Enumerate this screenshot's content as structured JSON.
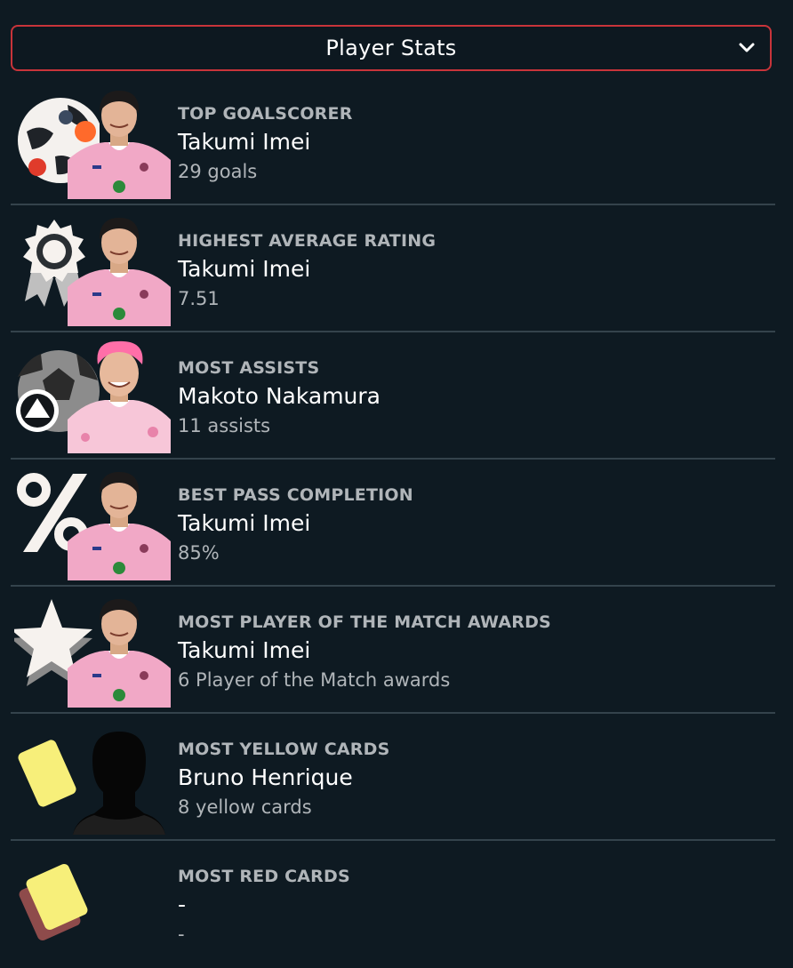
{
  "header": {
    "dropdown_label": "Player Stats",
    "dropdown_icon": "chevron-down-icon"
  },
  "colors": {
    "background": "#0e1a22",
    "dropdown_border": "#c8343a",
    "divider": "#34434c",
    "category_text": "#b0b5b9",
    "player_text": "#ffffff",
    "value_text": "#b0b5b9",
    "jersey_pink": "#f1a8c6",
    "yellow_card": "#f7ef7a",
    "red_card_dark": "#8e4b4b"
  },
  "stats": [
    {
      "category": "TOP GOALSCORER",
      "player": "Takumi Imei",
      "value": "29 goals",
      "icon": "soccer-ball-icon",
      "portrait": "player-portrait"
    },
    {
      "category": "HIGHEST AVERAGE RATING",
      "player": "Takumi Imei",
      "value": "7.51",
      "icon": "award-rosette-icon",
      "portrait": "player-portrait"
    },
    {
      "category": "MOST ASSISTS",
      "player": "Makoto Nakamura",
      "value": "11 assists",
      "icon": "assist-ball-icon",
      "portrait": "player-portrait-pink-hair"
    },
    {
      "category": "BEST PASS COMPLETION",
      "player": "Takumi Imei",
      "value": "85%",
      "icon": "percent-icon",
      "portrait": "player-portrait"
    },
    {
      "category": "MOST PLAYER OF THE MATCH AWARDS",
      "player": "Takumi Imei",
      "value": "6 Player of the Match awards",
      "icon": "star-icon",
      "portrait": "player-portrait"
    },
    {
      "category": "MOST YELLOW CARDS",
      "player": "Bruno Henrique",
      "value": "8 yellow cards",
      "icon": "yellow-card-icon",
      "portrait": "silhouette-portrait"
    },
    {
      "category": "MOST RED CARDS",
      "player": "-",
      "value": "-",
      "icon": "red-card-icon",
      "portrait": ""
    }
  ]
}
